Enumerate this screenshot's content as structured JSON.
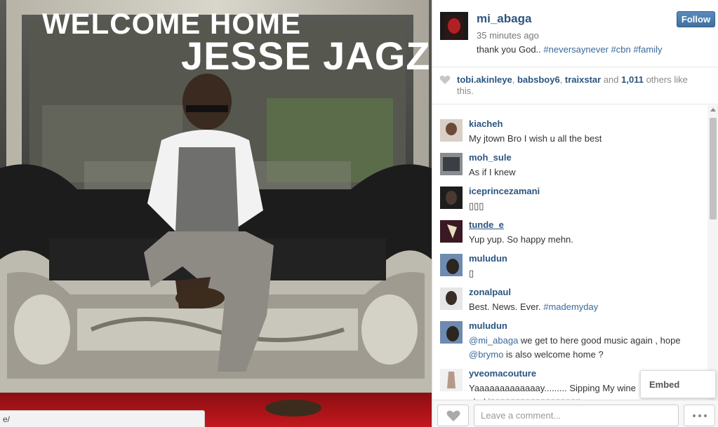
{
  "photo": {
    "title_line1": "WELCOME HOME",
    "title_line2": "JESSE JAGZ",
    "status_url": "e/"
  },
  "post": {
    "owner": "mi_abaga",
    "time_ago": "35 minutes ago",
    "caption_text": " thank you God..",
    "caption_hashtags": "#neversaynever #cbn #family",
    "follow_label": "Follow"
  },
  "likes": {
    "user1": "tobi.akinleye",
    "sep1": ", ",
    "user2": "babsboy6",
    "sep2": ", ",
    "user3": "traixstar",
    "and": " and ",
    "count": "1,011",
    "suffix": " others like this."
  },
  "comments": [
    {
      "user": "kiacheh",
      "text": "My jtown Bro I wish u all the best"
    },
    {
      "user": "moh_sule",
      "text": "As if I knew"
    },
    {
      "user": "iceprincezamani",
      "text": ""
    },
    {
      "user": "tunde_e",
      "text": "Yup yup. So happy mehn."
    },
    {
      "user": "muludun",
      "text": ""
    },
    {
      "user": "zonalpaul",
      "text": "Best. News. Ever.",
      "tag": "#mademyday"
    },
    {
      "user": "muludun",
      "mention1": "@mi_abaga",
      "text": " we get to here good music again , hope",
      "mention2": "@brymo",
      "text2": " is also welcome home ?"
    },
    {
      "user": "yveomacouture",
      "text": "Yaaaaaaaaaaaaay......... Sipping My wine",
      "text2": "shoki"
    }
  ],
  "embed_label": "Embed",
  "footer": {
    "comment_placeholder": "Leave a comment..."
  },
  "colors": {
    "link": "#2b5580",
    "hashtag": "#3b6a9a",
    "follow_bg": "#4a7aab"
  },
  "icons": [
    "heart-icon",
    "more-dots-icon",
    "scroll-up-icon",
    "scroll-down-icon"
  ]
}
